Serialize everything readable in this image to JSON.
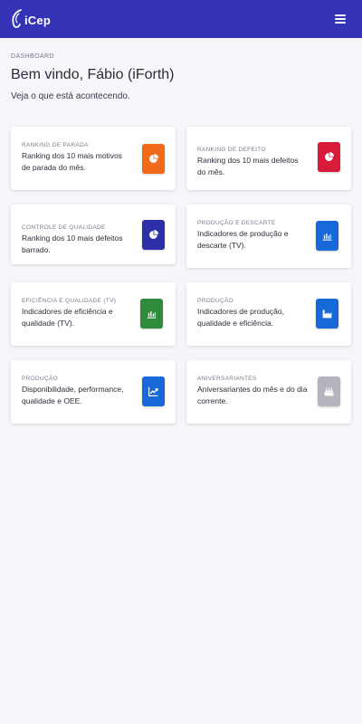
{
  "brand": {
    "logo_text": "iCep"
  },
  "header": {
    "breadcrumb": "DASHBOARD",
    "title": "Bem vindo, Fábio (iForth)",
    "subtitle": "Veja o que está acontecendo."
  },
  "cards": [
    {
      "category": "RANKING DE PARADA",
      "description": "Ranking dos 10 mais motivos de parada do mês.",
      "icon": "pie-chart-icon",
      "color": "#f06a1a"
    },
    {
      "category": "RANKING DE DEFEITO",
      "description": "Ranking dos 10 mais defeitos do mês.",
      "icon": "pie-chart-icon",
      "color": "#d81b3b"
    },
    {
      "category": "CONTROLE DE QUALIDADE",
      "description": "Ranking dos 10 mais defeitos barrado.",
      "icon": "pie-chart-icon",
      "color": "#2d2fa8"
    },
    {
      "category": "PRODUÇÃO E DESCARTE",
      "description": "Indicadores de produção e descarte (TV).",
      "icon": "bar-chart-icon",
      "color": "#1768d8"
    },
    {
      "category": "EFICIÊNCIA E QUALIDADE (TV)",
      "description": "Indicadores de eficiência e qualidade (TV).",
      "icon": "bar-chart-icon",
      "color": "#2e8b3a"
    },
    {
      "category": "PRODUÇÃO",
      "description": "Indicadores de produção, qualidade e eficiência.",
      "icon": "factory-icon",
      "color": "#1768d8"
    },
    {
      "category": "PRODUÇÃO",
      "description": "Disponibilidade, performance, qualidade e OEE.",
      "icon": "trending-chart-icon",
      "color": "#1768d8"
    },
    {
      "category": "ANIVERSARIANTES",
      "description": "Aniversariantes do mês e do dia corrente.",
      "icon": "cake-icon",
      "color": "#b7b3be"
    }
  ]
}
